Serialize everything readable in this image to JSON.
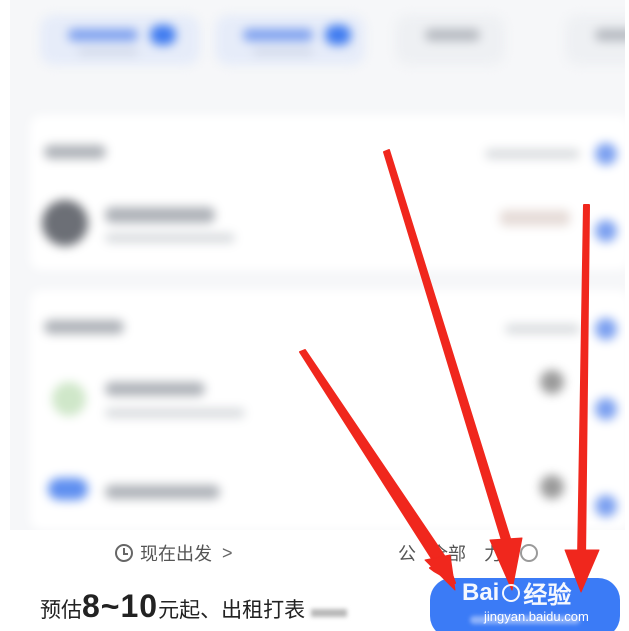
{
  "bottom_bar": {
    "depart_label": "现在出发",
    "chevron": ">",
    "all_cars_prefix": "公",
    "all_cars_label": "全部",
    "all_cars_suffix": "力",
    "estimate_prefix": "预估",
    "estimate_range": "8~10",
    "estimate_suffix": "元起、出租打表"
  },
  "watermark": {
    "logo_left": "Bai",
    "logo_right": "经验",
    "url": "jingyan.baidu.com"
  },
  "colors": {
    "accent": "#3b7bf6",
    "arrow": "#f0271d"
  },
  "icons": [
    "clock-icon",
    "chevron-right-icon",
    "toggle-circle-icon",
    "arrow-icon"
  ]
}
